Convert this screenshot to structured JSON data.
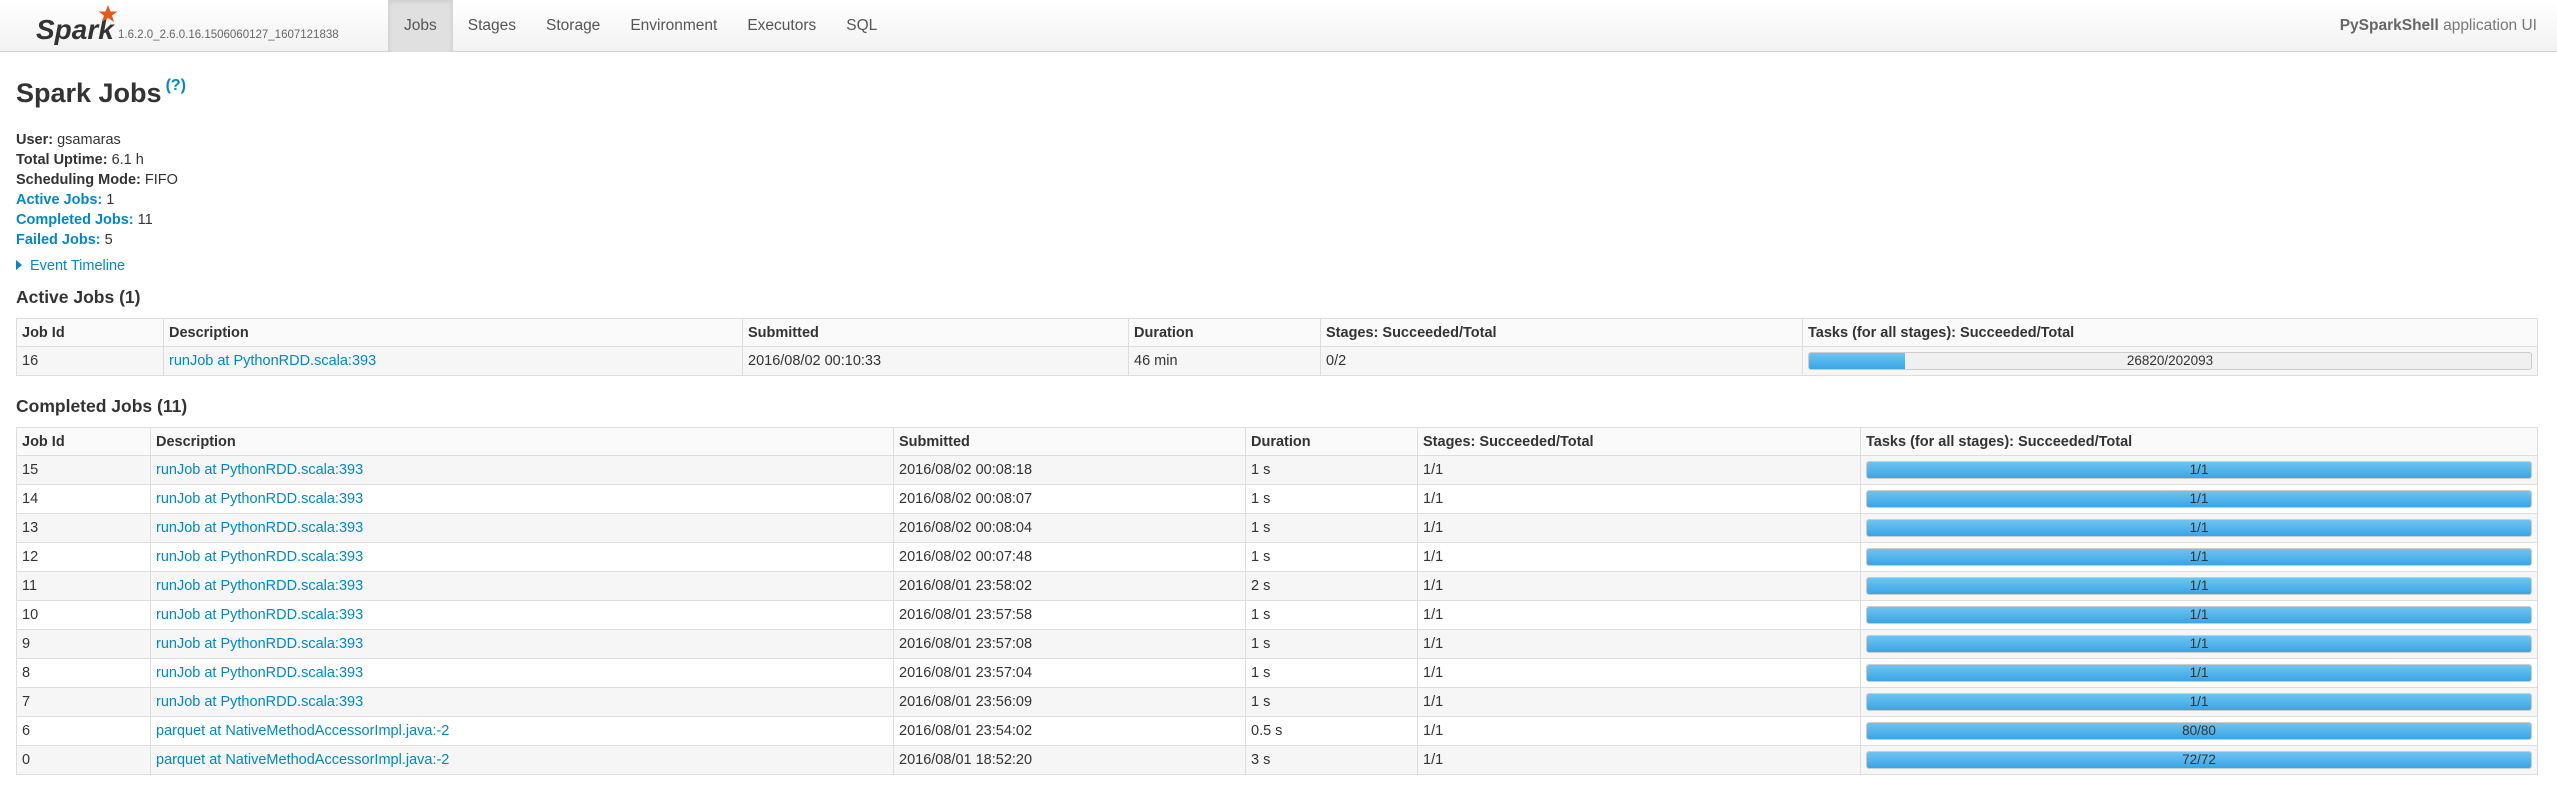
{
  "nav": {
    "brand_version": "1.6.2.0_2.6.0.16.1506060127_1607121838",
    "tabs": [
      {
        "label": "Jobs",
        "active": true
      },
      {
        "label": "Stages",
        "active": false
      },
      {
        "label": "Storage",
        "active": false
      },
      {
        "label": "Environment",
        "active": false
      },
      {
        "label": "Executors",
        "active": false
      },
      {
        "label": "SQL",
        "active": false
      }
    ],
    "app_name_bold": "PySparkShell",
    "app_name_suffix": " application UI"
  },
  "page": {
    "title": "Spark Jobs",
    "help": "(?)"
  },
  "summary": {
    "user_label": "User:",
    "user": "gsamaras",
    "uptime_label": "Total Uptime:",
    "uptime": "6.1 h",
    "mode_label": "Scheduling Mode:",
    "mode": "FIFO",
    "active_label": "Active Jobs:",
    "active": "1",
    "completed_label": "Completed Jobs:",
    "completed": "11",
    "failed_label": "Failed Jobs:",
    "failed": "5"
  },
  "timeline_label": "Event Timeline",
  "active_jobs": {
    "title": "Active Jobs (1)",
    "headers": [
      "Job Id",
      "Description",
      "Submitted",
      "Duration",
      "Stages: Succeeded/Total",
      "Tasks (for all stages): Succeeded/Total"
    ],
    "rows": [
      {
        "id": "16",
        "desc": "runJob at PythonRDD.scala:393",
        "submitted": "2016/08/02 00:10:33",
        "duration": "46 min",
        "stages": "0/2",
        "tasks": "26820/202093",
        "progress": 0.1327
      }
    ]
  },
  "completed_jobs": {
    "title": "Completed Jobs (11)",
    "headers": [
      "Job Id",
      "Description",
      "Submitted",
      "Duration",
      "Stages: Succeeded/Total",
      "Tasks (for all stages): Succeeded/Total"
    ],
    "rows": [
      {
        "id": "15",
        "desc": "runJob at PythonRDD.scala:393",
        "submitted": "2016/08/02 00:08:18",
        "duration": "1 s",
        "stages": "1/1",
        "tasks": "1/1",
        "progress": 1
      },
      {
        "id": "14",
        "desc": "runJob at PythonRDD.scala:393",
        "submitted": "2016/08/02 00:08:07",
        "duration": "1 s",
        "stages": "1/1",
        "tasks": "1/1",
        "progress": 1
      },
      {
        "id": "13",
        "desc": "runJob at PythonRDD.scala:393",
        "submitted": "2016/08/02 00:08:04",
        "duration": "1 s",
        "stages": "1/1",
        "tasks": "1/1",
        "progress": 1
      },
      {
        "id": "12",
        "desc": "runJob at PythonRDD.scala:393",
        "submitted": "2016/08/02 00:07:48",
        "duration": "1 s",
        "stages": "1/1",
        "tasks": "1/1",
        "progress": 1
      },
      {
        "id": "11",
        "desc": "runJob at PythonRDD.scala:393",
        "submitted": "2016/08/01 23:58:02",
        "duration": "2 s",
        "stages": "1/1",
        "tasks": "1/1",
        "progress": 1
      },
      {
        "id": "10",
        "desc": "runJob at PythonRDD.scala:393",
        "submitted": "2016/08/01 23:57:58",
        "duration": "1 s",
        "stages": "1/1",
        "tasks": "1/1",
        "progress": 1
      },
      {
        "id": "9",
        "desc": "runJob at PythonRDD.scala:393",
        "submitted": "2016/08/01 23:57:08",
        "duration": "1 s",
        "stages": "1/1",
        "tasks": "1/1",
        "progress": 1
      },
      {
        "id": "8",
        "desc": "runJob at PythonRDD.scala:393",
        "submitted": "2016/08/01 23:57:04",
        "duration": "1 s",
        "stages": "1/1",
        "tasks": "1/1",
        "progress": 1
      },
      {
        "id": "7",
        "desc": "runJob at PythonRDD.scala:393",
        "submitted": "2016/08/01 23:56:09",
        "duration": "1 s",
        "stages": "1/1",
        "tasks": "1/1",
        "progress": 1
      },
      {
        "id": "6",
        "desc": "parquet at NativeMethodAccessorImpl.java:-2",
        "submitted": "2016/08/01 23:54:02",
        "duration": "0.5 s",
        "stages": "1/1",
        "tasks": "80/80",
        "progress": 1
      },
      {
        "id": "0",
        "desc": "parquet at NativeMethodAccessorImpl.java:-2",
        "submitted": "2016/08/01 18:52:20",
        "duration": "3 s",
        "stages": "1/1",
        "tasks": "72/72",
        "progress": 1
      }
    ]
  },
  "colors": {
    "link": "#0088cc",
    "progress": "#39a5e6",
    "spark_star": "#e25a1c"
  }
}
